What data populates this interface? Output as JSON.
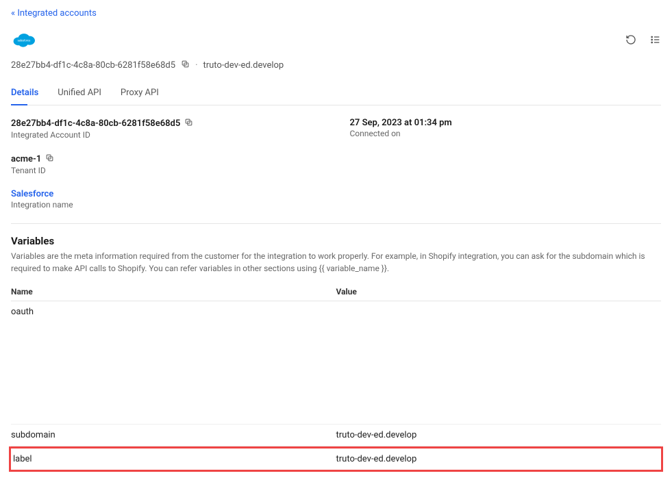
{
  "nav": {
    "back_label": "« Integrated accounts"
  },
  "logo": {
    "name": "salesforce-logo"
  },
  "header_actions": {
    "refresh": "refresh",
    "list": "list"
  },
  "breadcrumb": {
    "id": "28e27bb4-df1c-4c8a-80cb-6281f58e68d5",
    "suffix": "truto-dev-ed.develop"
  },
  "tabs": [
    {
      "label": "Details",
      "active": true
    },
    {
      "label": "Unified API",
      "active": false
    },
    {
      "label": "Proxy API",
      "active": false
    }
  ],
  "details": {
    "integrated_account_id": {
      "value": "28e27bb4-df1c-4c8a-80cb-6281f58e68d5",
      "label": "Integrated Account ID"
    },
    "connected_on": {
      "value": "27 Sep, 2023 at 01:34 pm",
      "label": "Connected on"
    },
    "tenant": {
      "value": "acme-1",
      "label": "Tenant ID"
    },
    "integration": {
      "value": "Salesforce",
      "label": "Integration name"
    }
  },
  "variables": {
    "title": "Variables",
    "description": "Variables are the meta information required from the customer for the integration to work properly. For example, in Shopify integration, you can ask for the subdomain which is required to make API calls to Shopify. You can refer variables in other sections using {{ variable_name }}.",
    "columns": {
      "name": "Name",
      "value": "Value"
    },
    "rows": [
      {
        "name": "oauth",
        "value": ""
      },
      {
        "name": "subdomain",
        "value": "truto-dev-ed.develop"
      },
      {
        "name": "label",
        "value": "truto-dev-ed.develop"
      }
    ]
  }
}
